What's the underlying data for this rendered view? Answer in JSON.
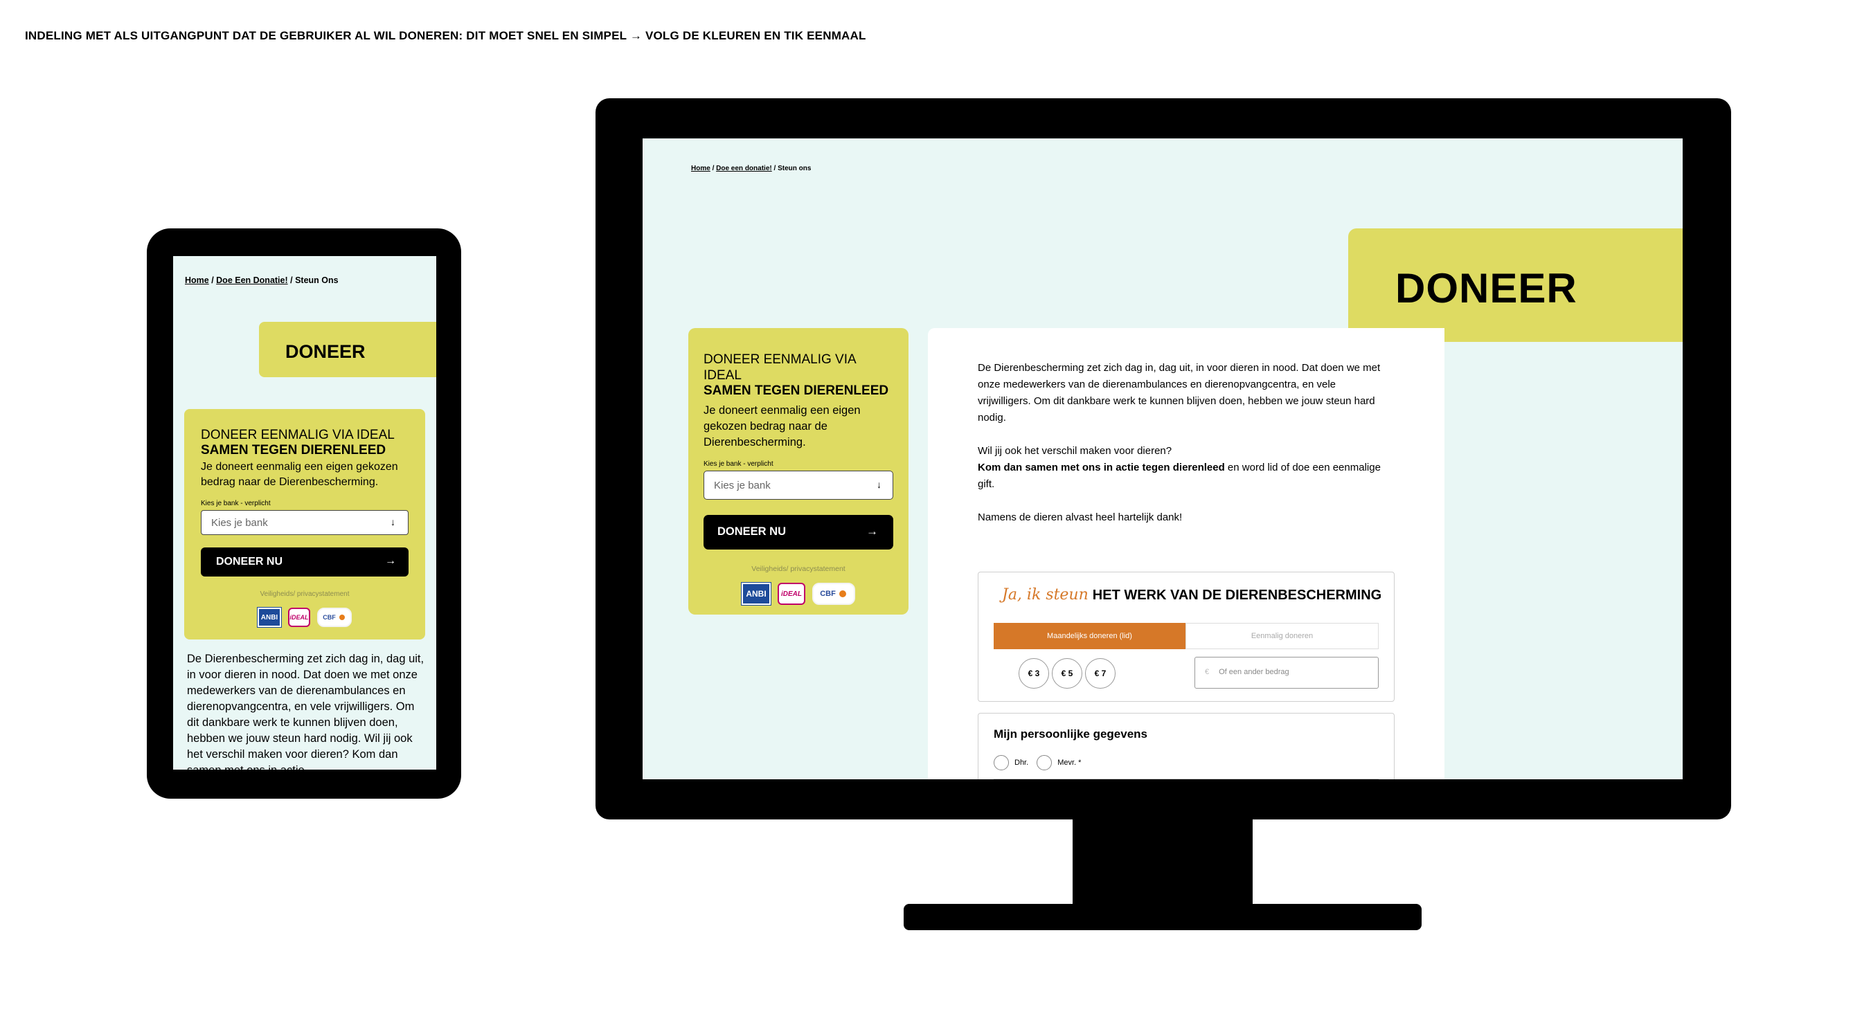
{
  "caption": "INDELING MET ALS UITGANGPUNT DAT DE GEBRUIKER AL WIL DONEREN: DIT MOET SNEL EN SIMPEL → VOLG DE KLEUREN EN TIK EENMAAL",
  "colors": {
    "yellow": "#dedb62",
    "mint": "#e9f7f5",
    "orange": "#d67828",
    "black": "#000000"
  },
  "tablet": {
    "breadcrumb": {
      "home": "Home",
      "sep": " / ",
      "donate": "Doe Een Donatie!",
      "current": "Steun Ons"
    },
    "tag": "DONEER",
    "card": {
      "heading1": "DONEER EENMALIG VIA IDEAL",
      "heading2": "SAMEN TEGEN DIERENLEED",
      "text": "Je doneert eenmalig een eigen gekozen bedrag naar de Dierenbescherming.",
      "bank_label": "Kies je bank - verplicht",
      "bank_placeholder": "Kies je bank",
      "button": "DONEER NU",
      "privacy": "Veiligheids/ privacystatement"
    },
    "body_text": "De Dierenbescherming zet zich dag in, dag uit, in voor dieren in nood. Dat doen we met onze medewerkers van de dierenambulances en dierenopvangcentra, en vele vrijwilligers. Om dit dankbare werk te kunnen blijven doen, hebben we jouw steun hard nodig. Wil jij ook het verschil maken voor dieren? Kom dan samen met ons in actie"
  },
  "desktop": {
    "breadcrumb": {
      "home": "Home",
      "sep": " / ",
      "donate": "Doe een donatie!",
      "current": "Steun ons"
    },
    "tag": "DONEER",
    "card": {
      "heading1": "DONEER EENMALIG VIA IDEAL",
      "heading2": "SAMEN TEGEN DIERENLEED",
      "text": "Je doneert eenmalig een eigen gekozen bedrag naar de Dierenbescherming.",
      "bank_label": "Kies je bank - verplicht",
      "bank_placeholder": "Kies je bank",
      "button": "DONEER NU",
      "privacy": "Veiligheids/ privacystatement"
    },
    "intro": {
      "p1": "De Dierenbescherming zet zich dag in, dag uit, in voor dieren in nood. Dat doen we met onze medewerkers van de dierenambulances en dierenopvangcentra, en vele vrijwilligers. Om dit dankbare werk te kunnen blijven doen, hebben we jouw steun hard nodig.",
      "p2_question": "Wil jij ook het verschil maken voor dieren?",
      "p2_bold": "Kom dan samen met ons in actie tegen dierenleed",
      "p2_rest": " en word lid of doe een eenmalige gift.",
      "p3": "Namens de dieren alvast heel hartelijk dank!"
    },
    "form": {
      "heading_script": "Ja, ik steun",
      "heading_bold": "HET WERK VAN DE DIERENBESCHERMING",
      "tab_monthly": "Maandelijks doneren (lid)",
      "tab_once": "Eenmalig doneren",
      "amounts": [
        "€ 3",
        "€ 5",
        "€ 7"
      ],
      "other_currency": "€",
      "other_placeholder": "Of een ander bedrag"
    },
    "personal": {
      "title": "Mijn persoonlijke gegevens",
      "options": [
        "Dhr.",
        "Mevr. *"
      ]
    }
  },
  "logos": {
    "anbi": "ANBI",
    "ideal": "iDEAL",
    "cbf": "CBF"
  }
}
